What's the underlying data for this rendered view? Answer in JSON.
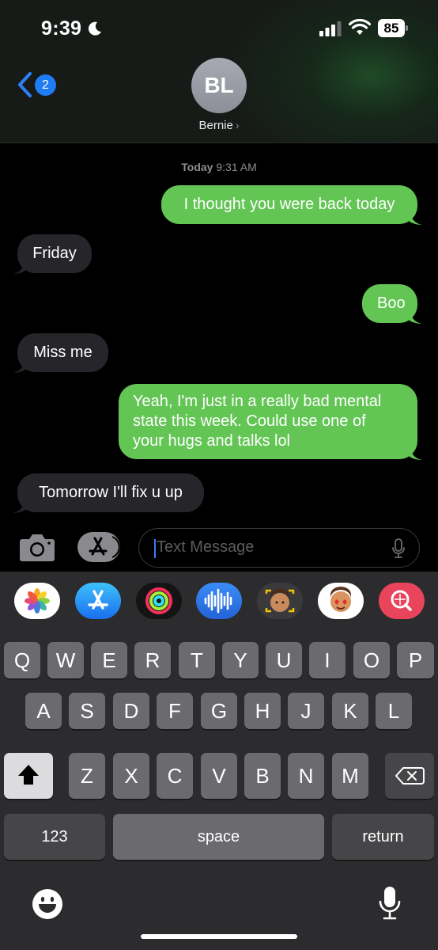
{
  "status_bar": {
    "time": "9:39",
    "battery": "85"
  },
  "header": {
    "back_badge": "2",
    "avatar_initials": "BL",
    "contact_name": "Bernie"
  },
  "thread": {
    "timestamp_day": "Today",
    "timestamp_time": "9:31 AM",
    "messages": [
      {
        "from": "me",
        "text": "I thought you were back today"
      },
      {
        "from": "them",
        "text": "Friday"
      },
      {
        "from": "me",
        "text": "Boo"
      },
      {
        "from": "them",
        "text": "Miss me"
      },
      {
        "from": "me",
        "line1": "Yeah, I'm just in a really bad mental",
        "line2": "state this week. Could use one of",
        "line3": "your hugs and talks lol"
      },
      {
        "from": "them",
        "text": "Tomorrow I'll fix u up"
      }
    ]
  },
  "compose": {
    "placeholder": "Text Message"
  },
  "keyboard": {
    "row1": [
      "Q",
      "W",
      "E",
      "R",
      "T",
      "Y",
      "U",
      "I",
      "O",
      "P"
    ],
    "row2": [
      "A",
      "S",
      "D",
      "F",
      "G",
      "H",
      "J",
      "K",
      "L"
    ],
    "row3": [
      "Z",
      "X",
      "C",
      "V",
      "B",
      "N",
      "M"
    ],
    "numbers_label": "123",
    "space_label": "space",
    "return_label": "return"
  },
  "app_strip": [
    "photos-app",
    "app-store-app",
    "activity-app",
    "audio-message-app",
    "memoji-app",
    "memoji-stickers-app",
    "search-images-app"
  ],
  "colors": {
    "sent_bubble": "#62c554",
    "received_bubble": "#26262a",
    "accent": "#1e7cf5"
  }
}
